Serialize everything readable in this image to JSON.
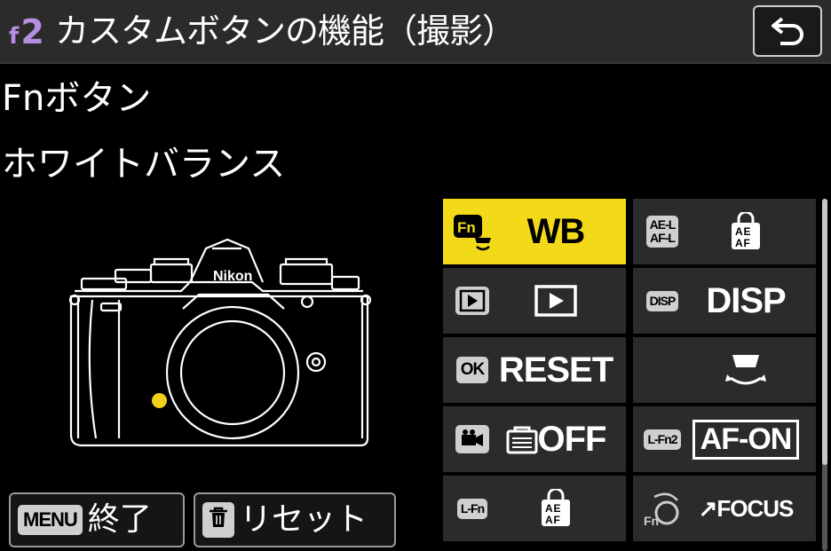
{
  "header": {
    "menu_code_prefix": "f",
    "menu_code": "2",
    "title": "カスタムボタンの機能（撮影）",
    "back_icon": "return-arrow-icon"
  },
  "control": {
    "name": "Fnボタン"
  },
  "function": {
    "name": "ホワイトバランス"
  },
  "camera": {
    "brand": "Nikon",
    "highlight_color": "#f2d11a"
  },
  "grid": {
    "cells": [
      {
        "badge": "Fn",
        "value": "WB",
        "selected": true,
        "icon": "fn-button-icon"
      },
      {
        "badge": "AE-L AF-L",
        "value": "",
        "selected": false,
        "icon": "ae-af-lock-icon"
      },
      {
        "badge": "",
        "value": "",
        "selected": false,
        "icon": "playback-icon"
      },
      {
        "badge": "DISP",
        "value": "DISP",
        "selected": false,
        "icon": "disp-icon"
      },
      {
        "badge": "OK",
        "value": "RESET",
        "selected": false,
        "icon": "ok-button-icon"
      },
      {
        "badge": "",
        "value": "",
        "selected": false,
        "icon": "sub-command-dial-icon"
      },
      {
        "badge": "",
        "value": "OFF",
        "selected": false,
        "icon": "movie-record-icon"
      },
      {
        "badge": "L-Fn2",
        "value": "AF-ON",
        "selected": false,
        "icon": "lens-fn2-icon"
      },
      {
        "badge": "L-Fn",
        "value": "",
        "selected": false,
        "icon": "lens-fn-icon"
      },
      {
        "badge": "Fn",
        "value": "FOCUS",
        "selected": false,
        "icon": "lens-control-ring-icon"
      }
    ]
  },
  "footer": {
    "menu_key": "MENU",
    "menu_label": "終了",
    "reset_label": "リセット"
  },
  "colors": {
    "selected": "#f2da1a",
    "accent": "#b48ee0"
  }
}
